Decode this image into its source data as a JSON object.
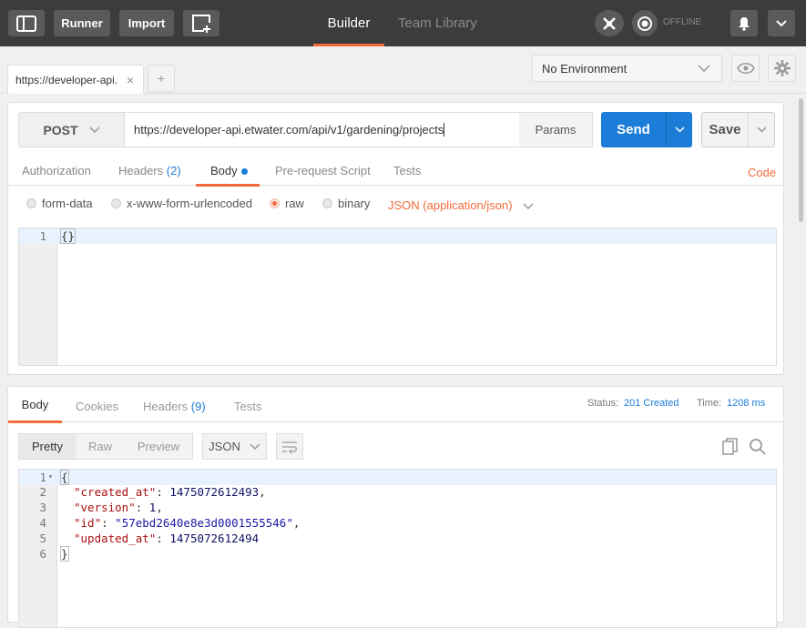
{
  "topbar": {
    "runner": "Runner",
    "import": "Import",
    "builder": "Builder",
    "team_library": "Team Library",
    "offline": "OFFLINE"
  },
  "request_tab": {
    "title": "https://developer-api.",
    "add": "+"
  },
  "environment": {
    "selected": "No Environment"
  },
  "request": {
    "method": "POST",
    "url": "https://developer-api.etwater.com/api/v1/gardening/projects",
    "params": "Params",
    "send": "Send",
    "save": "Save"
  },
  "req_tabs": {
    "authorization": "Authorization",
    "headers": "Headers",
    "headers_count": "(2)",
    "body": "Body",
    "prerequest": "Pre-request Script",
    "tests": "Tests",
    "code": "Code"
  },
  "body_modes": {
    "form_data": "form-data",
    "urlencoded": "x-www-form-urlencoded",
    "raw": "raw",
    "binary": "binary",
    "content_type": "JSON (application/json)"
  },
  "request_body": {
    "lines": [
      "1"
    ],
    "content": "{}"
  },
  "response": {
    "tabs": {
      "body": "Body",
      "cookies": "Cookies",
      "headers": "Headers",
      "headers_count": "(9)",
      "tests": "Tests"
    },
    "status_label": "Status:",
    "status_value": "201 Created",
    "time_label": "Time:",
    "time_value": "1208 ms",
    "view": {
      "pretty": "Pretty",
      "raw": "Raw",
      "preview": "Preview",
      "format": "JSON"
    },
    "line_numbers": [
      "1",
      "2",
      "3",
      "4",
      "5",
      "6"
    ],
    "json": {
      "open": "{",
      "created_at_key": "\"created_at\"",
      "created_at_val": "1475072612493",
      "version_key": "\"version\"",
      "version_val": "1",
      "id_key": "\"id\"",
      "id_val": "\"57ebd2640e8e3d0001555546\"",
      "updated_at_key": "\"updated_at\"",
      "updated_at_val": "1475072612494",
      "close": "}"
    }
  },
  "colors": {
    "accent": "#f26b3a",
    "send_blue": "#1b7dd8",
    "status_blue": "#1b7dd8",
    "topbar": "#3c3c3c"
  }
}
